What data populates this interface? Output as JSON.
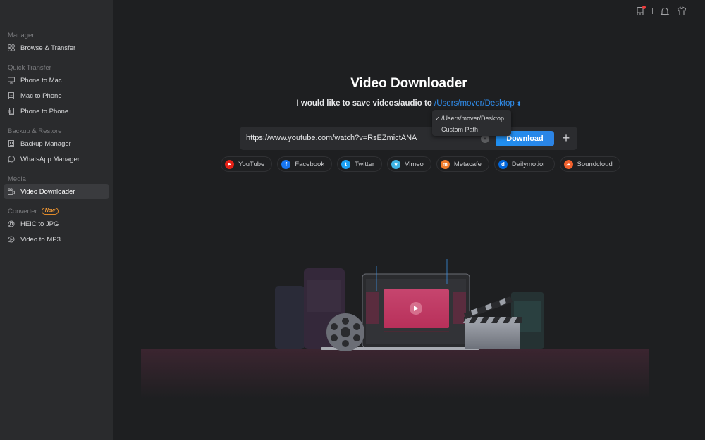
{
  "sidebar": {
    "sections": [
      {
        "label": "Manager",
        "items": [
          {
            "label": "Browse & Transfer",
            "icon": "grid-icon"
          }
        ]
      },
      {
        "label": "Quick Transfer",
        "items": [
          {
            "label": "Phone to Mac",
            "icon": "monitor-icon"
          },
          {
            "label": "Mac to Phone",
            "icon": "phone-in-icon"
          },
          {
            "label": "Phone to Phone",
            "icon": "phone-transfer-icon"
          }
        ]
      },
      {
        "label": "Backup & Restore",
        "items": [
          {
            "label": "Backup Manager",
            "icon": "backup-icon"
          },
          {
            "label": "WhatsApp Manager",
            "icon": "whatsapp-icon"
          }
        ]
      },
      {
        "label": "Media",
        "items": [
          {
            "label": "Video Downloader",
            "icon": "video-camera-icon",
            "active": true
          }
        ]
      },
      {
        "label": "Converter",
        "badge": "New",
        "items": [
          {
            "label": "HEIC to JPG",
            "icon": "image-convert-icon"
          },
          {
            "label": "Video to MP3",
            "icon": "audio-convert-icon"
          }
        ]
      }
    ]
  },
  "topbar": {
    "icons": [
      "device-icon",
      "bell-icon",
      "tshirt-icon"
    ],
    "notification_dot_color": "#f23b3b"
  },
  "main": {
    "title": "Video Downloader",
    "save_prefix": "I would like to save videos/audio to",
    "save_path": "/Users/mover/Desktop",
    "path_dropdown": {
      "options": [
        {
          "label": "/Users/mover/Desktop",
          "checked": true
        },
        {
          "label": "Custom Path",
          "checked": false
        }
      ]
    },
    "url_input": {
      "value": "https://www.youtube.com/watch?v=RsEZmictANA"
    },
    "download_label": "Download",
    "add_label": "+",
    "sites": [
      {
        "label": "YouTube",
        "color": "#e62117",
        "glyph": "▶"
      },
      {
        "label": "Facebook",
        "color": "#1877f2",
        "glyph": "f"
      },
      {
        "label": "Twitter",
        "color": "#1da1f2",
        "glyph": "t"
      },
      {
        "label": "Vimeo",
        "color": "#40b4e5",
        "glyph": "v"
      },
      {
        "label": "Metacafe",
        "color": "#f07b2a",
        "glyph": "m"
      },
      {
        "label": "Dailymotion",
        "color": "#0066dc",
        "glyph": "d"
      },
      {
        "label": "Soundcloud",
        "color": "#f2612d",
        "glyph": "☁"
      }
    ],
    "accent_color": "#2f8ff0"
  }
}
